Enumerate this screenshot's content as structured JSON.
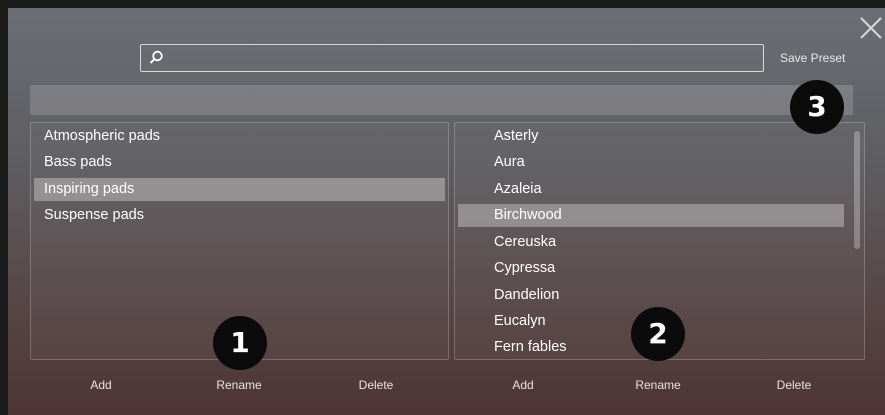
{
  "search": {
    "value": "",
    "placeholder": ""
  },
  "save_preset_label": "Save Preset",
  "left_list": {
    "items": [
      "Atmospheric pads",
      "Bass pads",
      "Inspiring pads",
      "Suspense pads"
    ],
    "selected": "Inspiring pads"
  },
  "right_list": {
    "items": [
      "Asterly",
      "Aura",
      "Azaleia",
      "Birchwood",
      "Cereuska",
      "Cypressa",
      "Dandelion",
      "Eucalyn",
      "Fern fables"
    ],
    "selected": "Birchwood"
  },
  "left_actions": {
    "add": "Add",
    "rename": "Rename",
    "delete": "Delete"
  },
  "right_actions": {
    "add": "Add",
    "rename": "Rename",
    "delete": "Delete"
  },
  "badges": [
    "1",
    "2",
    "3"
  ],
  "icons": {
    "close": "close-icon",
    "search": "search-icon"
  }
}
